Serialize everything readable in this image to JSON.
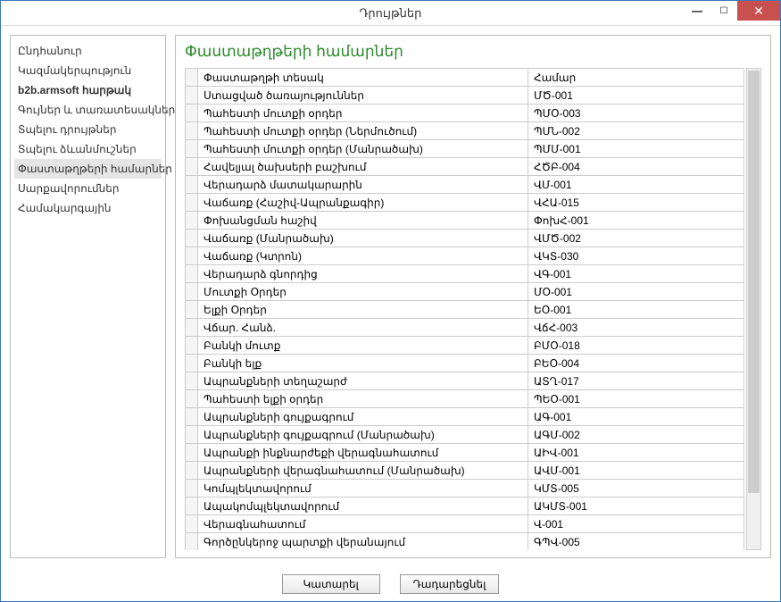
{
  "window": {
    "title": "Դրույթներ"
  },
  "sidebar": {
    "items": [
      {
        "label": "Ընդհանուր",
        "bold": false,
        "selected": false
      },
      {
        "label": "Կազմակերպություն",
        "bold": false,
        "selected": false
      },
      {
        "label": "b2b.armsoft հարթակ",
        "bold": true,
        "selected": false
      },
      {
        "label": "Գույներ և տառատեսակներ",
        "bold": false,
        "selected": false
      },
      {
        "label": "Տպելու դրույթներ",
        "bold": false,
        "selected": false
      },
      {
        "label": "Տպելու ձևանմուշներ",
        "bold": false,
        "selected": false
      },
      {
        "label": "Փաստաթղթերի համարներ",
        "bold": false,
        "selected": true
      },
      {
        "label": "Սարքավորումներ",
        "bold": false,
        "selected": false
      },
      {
        "label": "Համակարգային",
        "bold": false,
        "selected": false
      }
    ]
  },
  "main": {
    "title": "Փաստաթղթերի համարներ",
    "columns": {
      "type": "Փաստաթղթի տեսակ",
      "number": "Համար"
    },
    "rows": [
      {
        "type": "Ստացված ծառայություններ",
        "number": "ՄԾ-001"
      },
      {
        "type": "Պահեստի մուտքի օրդեր",
        "number": "ՊՄՕ-003"
      },
      {
        "type": "Պահեստի մուտքի օրդեր (Ներմուծում)",
        "number": "ՊՄՆ-002"
      },
      {
        "type": "Պահեստի մուտքի օրդեր (Մանրածախ)",
        "number": "ՊՄՄ-001"
      },
      {
        "type": "Հավելյալ ծախսերի բաշխում",
        "number": "ՀԾԲ-004"
      },
      {
        "type": "Վերադարձ մատակարարին",
        "number": "ՎՄ-001"
      },
      {
        "type": "Վաճառք (Հաշիվ-Ապրանքագիր)",
        "number": "ՎՀԱ-015"
      },
      {
        "type": "Փոխանցման հաշիվ",
        "number": "ՓոխՀ-001"
      },
      {
        "type": "Վաճառք (Մանրածախ)",
        "number": "ՎՄԾ-002"
      },
      {
        "type": "Վաճառք (Կտրոն)",
        "number": "ՎԿՏ-030"
      },
      {
        "type": "Վերադարձ գնորդից",
        "number": "ՎԳ-001"
      },
      {
        "type": "Մուտքի Օրդեր",
        "number": "ՄՕ-001"
      },
      {
        "type": "Ելքի Օրդեր",
        "number": "ԵՕ-001"
      },
      {
        "type": "Վճար. Հանձ.",
        "number": "ՎճՀ-003"
      },
      {
        "type": "Բանկի մուտք",
        "number": "ԲՄՕ-018"
      },
      {
        "type": "Բանկի ելք",
        "number": "ԲԵՕ-004"
      },
      {
        "type": "Ապրանքների տեղաշարժ",
        "number": "ԱՏՂ-017"
      },
      {
        "type": "Պահեստի ելքի օրդեր",
        "number": "ՊԵՕ-001"
      },
      {
        "type": "Ապրանքների գույքագրում",
        "number": "ԱԳ-001"
      },
      {
        "type": "Ապրանքների գույքագրում (Մանրածախ)",
        "number": "ԱԳՄ-002"
      },
      {
        "type": "Ապրանքի ինքնարժեքի վերագնահատում",
        "number": "ԱԻՎ-001"
      },
      {
        "type": "Ապրանքների վերագնահատում (Մանրածախ)",
        "number": "ԱՎՄ-001"
      },
      {
        "type": "Կոմպլեկտավորում",
        "number": "ԿՄՏ-005"
      },
      {
        "type": "Ապակոմպլեկտավորում",
        "number": "ԱԿՄՏ-001"
      },
      {
        "type": "Վերագնահատում",
        "number": "Վ-001"
      },
      {
        "type": "Գործընկերոջ պարտքի վերանայում",
        "number": "ԳՊՎ-005"
      }
    ]
  },
  "footer": {
    "ok": "Կատարել",
    "cancel": "Դադարեցնել"
  }
}
